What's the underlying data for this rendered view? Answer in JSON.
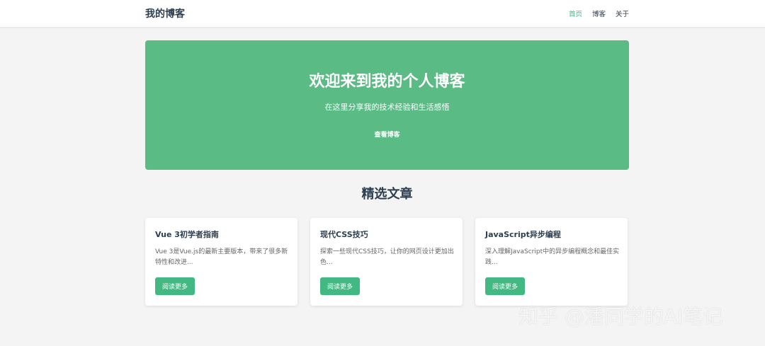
{
  "header": {
    "site_title": "我的博客",
    "nav": [
      {
        "label": "首页",
        "active": true
      },
      {
        "label": "博客",
        "active": false
      },
      {
        "label": "关于",
        "active": false
      }
    ]
  },
  "hero": {
    "title": "欢迎来到我的个人博客",
    "subtitle": "在这里分享我的技术经验和生活感悟",
    "button_label": "查看博客"
  },
  "featured": {
    "title": "精选文章",
    "cards": [
      {
        "title": "Vue 3初学者指南",
        "excerpt": "Vue 3是Vue.js的最新主要版本，带来了很多新特性和改进...",
        "button_label": "阅读更多"
      },
      {
        "title": "现代CSS技巧",
        "excerpt": "探索一些现代CSS技巧，让你的网页设计更加出色...",
        "button_label": "阅读更多"
      },
      {
        "title": "JavaScript异步编程",
        "excerpt": "深入理解JavaScript中的异步编程概念和最佳实践...",
        "button_label": "阅读更多"
      }
    ]
  },
  "watermark": "知乎 @潘同学的AI笔记",
  "colors": {
    "accent": "#42b983",
    "hero_bg": "#5abb84",
    "text": "#2c3e50"
  }
}
